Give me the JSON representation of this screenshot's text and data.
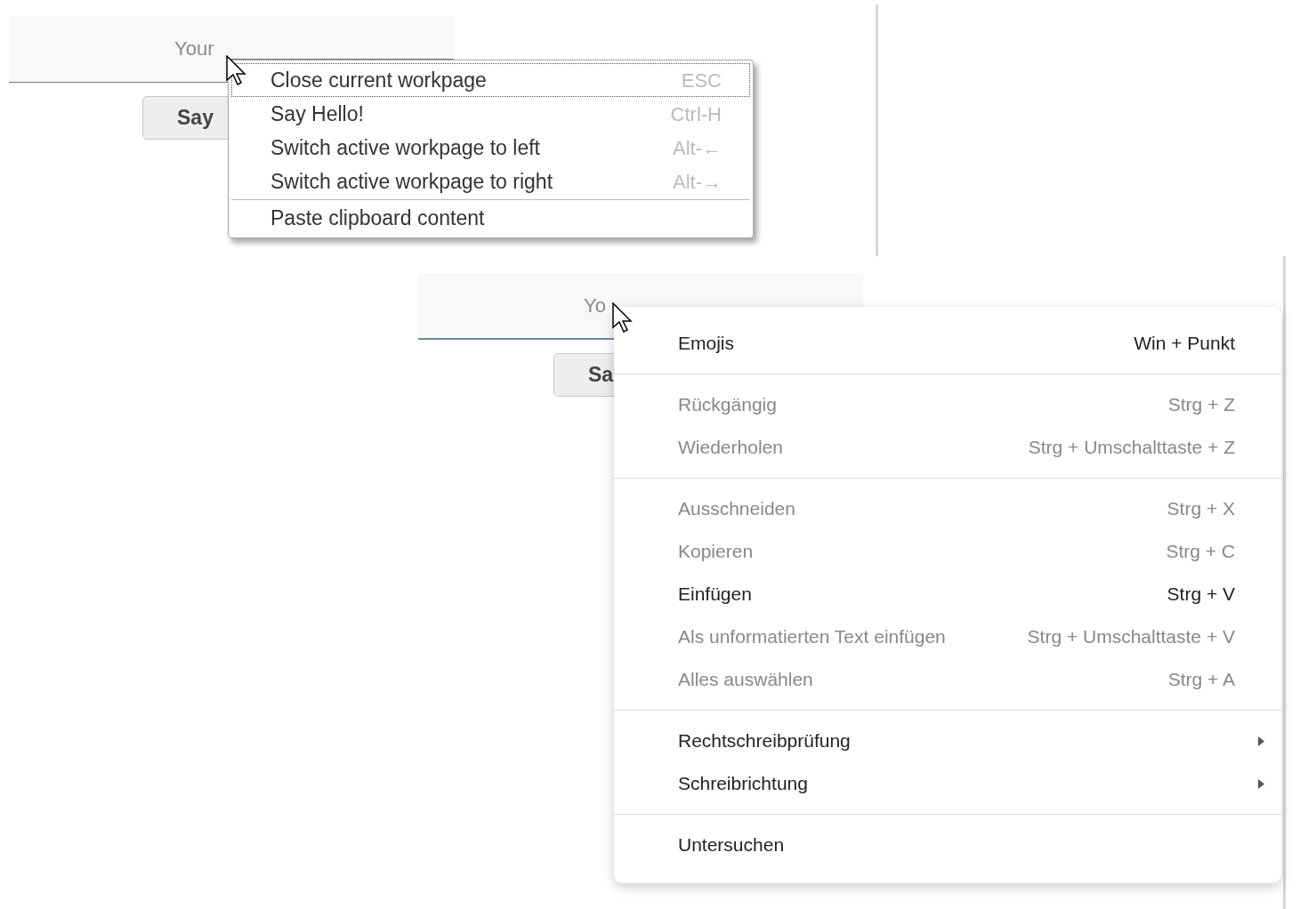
{
  "top_panel": {
    "name_field": {
      "placeholder": "Your"
    },
    "button": "Say",
    "menu": {
      "items": [
        {
          "kind": "item",
          "label": "Close current workpage",
          "shortcut": "ESC",
          "selected": true
        },
        {
          "kind": "item",
          "label": "Say Hello!",
          "shortcut": "Ctrl-H",
          "selected": false
        },
        {
          "kind": "item",
          "label": "Switch active workpage to left",
          "shortcut": "Alt-←",
          "selected": false
        },
        {
          "kind": "item",
          "label": "Switch active workpage to right",
          "shortcut": "Alt-→",
          "selected": false
        },
        {
          "kind": "separator"
        },
        {
          "kind": "item",
          "label": "Paste clipboard content",
          "selected": false
        }
      ]
    }
  },
  "bottom_panel": {
    "name_field": {
      "placeholder": "Yo"
    },
    "button": "Sa",
    "menu": {
      "items": [
        {
          "kind": "item",
          "label": "Emojis",
          "shortcut": "Win + Punkt",
          "disabled": false
        },
        {
          "kind": "separator"
        },
        {
          "kind": "item",
          "label": "Rückgängig",
          "shortcut": "Strg + Z",
          "disabled": true
        },
        {
          "kind": "item",
          "label": "Wiederholen",
          "shortcut": "Strg + Umschalttaste + Z",
          "disabled": true
        },
        {
          "kind": "separator"
        },
        {
          "kind": "item",
          "label": "Ausschneiden",
          "shortcut": "Strg + X",
          "disabled": true
        },
        {
          "kind": "item",
          "label": "Kopieren",
          "shortcut": "Strg + C",
          "disabled": true
        },
        {
          "kind": "item",
          "label": "Einfügen",
          "shortcut": "Strg + V",
          "disabled": false
        },
        {
          "kind": "item",
          "label": "Als unformatierten Text einfügen",
          "shortcut": "Strg + Umschalttaste + V",
          "disabled": true
        },
        {
          "kind": "item",
          "label": "Alles auswählen",
          "shortcut": "Strg + A",
          "disabled": true
        },
        {
          "kind": "separator"
        },
        {
          "kind": "submenu",
          "label": "Rechtschreibprüfung",
          "disabled": false
        },
        {
          "kind": "submenu",
          "label": "Schreibrichtung",
          "disabled": false
        },
        {
          "kind": "separator"
        },
        {
          "kind": "item",
          "label": "Untersuchen",
          "disabled": false
        }
      ]
    }
  }
}
